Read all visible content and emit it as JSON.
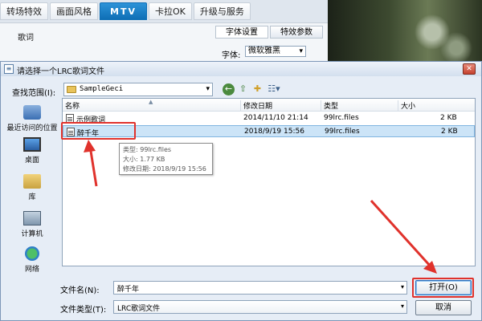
{
  "background_app": {
    "tabs": [
      "转场特效",
      "画面风格",
      "MTV",
      "卡拉OK",
      "升级与服务"
    ],
    "active_tab": "MTV",
    "lyric_label": "歌词",
    "subtabs": [
      "字体设置",
      "特效参数"
    ],
    "font_label": "字体:",
    "font_value": "微软雅黑"
  },
  "dialog": {
    "title": "请选择一个LRC歌词文件",
    "lookin_label": "查找范围(I):",
    "lookin_value": "SampleGeci",
    "places": [
      {
        "label": "最近访问的位置",
        "icon": "recent-places-icon"
      },
      {
        "label": "桌面",
        "icon": "desktop-icon"
      },
      {
        "label": "库",
        "icon": "library-icon"
      },
      {
        "label": "计算机",
        "icon": "computer-icon"
      },
      {
        "label": "网络",
        "icon": "network-icon"
      }
    ],
    "columns": {
      "name": "名称",
      "date": "修改日期",
      "type": "类型",
      "size": "大小"
    },
    "files": [
      {
        "name": "示例歌词",
        "date": "2014/11/10 21:14",
        "type": "99lrc.files",
        "size": "2 KB"
      },
      {
        "name": "醉千年",
        "date": "2018/9/19 15:56",
        "type": "99lrc.files",
        "size": "2 KB",
        "selected": true
      }
    ],
    "tooltip": {
      "type": "类型: 99lrc.files",
      "size": "大小: 1.77 KB",
      "modified": "修改日期: 2018/9/19 15:56"
    },
    "filename_label": "文件名(N):",
    "filename_value": "醉千年",
    "filetype_label": "文件类型(T):",
    "filetype_value": "LRC歌词文件",
    "open_button": "打开(O)",
    "cancel_button": "取消"
  },
  "colors": {
    "accent": "#0f6fb6",
    "selection": "#cce4f7",
    "annotation": "#e0322c"
  }
}
